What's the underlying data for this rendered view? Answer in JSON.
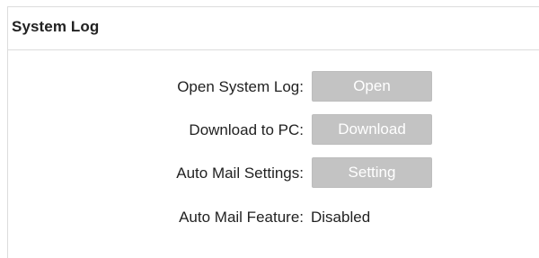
{
  "section": {
    "title": "System Log"
  },
  "rows": [
    {
      "label": "Open System Log:",
      "button_label": "Open"
    },
    {
      "label": "Download to PC:",
      "button_label": "Download"
    },
    {
      "label": "Auto Mail Settings:",
      "button_label": "Setting"
    }
  ],
  "auto_mail_feature": {
    "label": "Auto Mail Feature:",
    "value": "Disabled"
  },
  "colors": {
    "button_background": "#c3c3c3",
    "button_text": "#ffffff",
    "text": "#222222",
    "border": "#dcdcdc"
  }
}
